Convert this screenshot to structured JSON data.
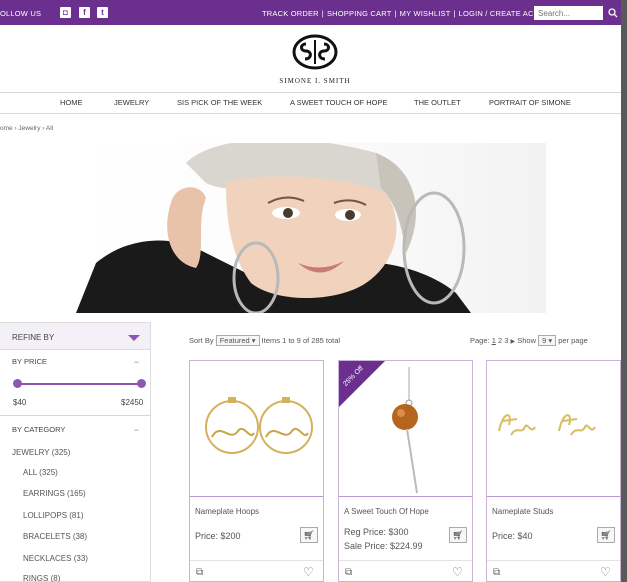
{
  "topbar": {
    "follow_label": "OLLOW US",
    "social": [
      {
        "icon": "instagram-icon",
        "glyph": "◘"
      },
      {
        "icon": "facebook-icon",
        "glyph": "f"
      },
      {
        "icon": "twitter-icon",
        "glyph": "t"
      }
    ],
    "links": [
      "TRACK ORDER",
      "SHOPPING CART",
      "MY WISHLIST",
      "LOGIN / CREATE ACCOUNT"
    ],
    "search_placeholder": "Search...",
    "search_icon": "search-icon",
    "bar_color": "#6b2f8e"
  },
  "logo": {
    "text": "SIMONE I. SMITH"
  },
  "nav": [
    "HOME",
    "JEWELRY",
    "SIS PICK OF THE WEEK",
    "A SWEET TOUCH OF HOPE",
    "THE OUTLET",
    "PORTRAIT OF SIMONE"
  ],
  "breadcrumb": "ome › Jewelry › All",
  "sidebar": {
    "refine_label": "REFINE BY",
    "price_label": "BY PRICE",
    "price_min": "$40",
    "price_max": "$2450",
    "category_label": "BY CATEGORY",
    "categories": [
      {
        "label": "JEWELRY",
        "count": "(325)"
      },
      {
        "label": "ALL",
        "count": "(325)"
      },
      {
        "label": "EARRINGS",
        "count": "(165)"
      },
      {
        "label": "LOLLIPOPS",
        "count": "(81)"
      },
      {
        "label": "BRACELETS",
        "count": "(38)"
      },
      {
        "label": "NECKLACES",
        "count": "(33)"
      },
      {
        "label": "RINGS",
        "count": "(8)"
      }
    ],
    "accent_color": "#8e56b3"
  },
  "sortbar": {
    "sort_label": "Sort By",
    "sort_value": "Featured",
    "items_text": "Items 1 to 9 of 285 total",
    "page_label": "Page:",
    "pages": [
      "1",
      "2",
      "3"
    ],
    "next_glyph": "▶",
    "show_label": "Show",
    "show_value": "9",
    "per_page_label": "per page"
  },
  "products": [
    {
      "name": "Nameplate Hoops",
      "price": "Price: $200",
      "badge": ""
    },
    {
      "name": "A Sweet Touch Of Hope",
      "reg_price": "Reg Price: $300",
      "sale_price": "Sale Price: $224.99",
      "badge": "25% Off"
    },
    {
      "name": "Nameplate Studs",
      "price": "Price: $40",
      "badge": ""
    }
  ]
}
